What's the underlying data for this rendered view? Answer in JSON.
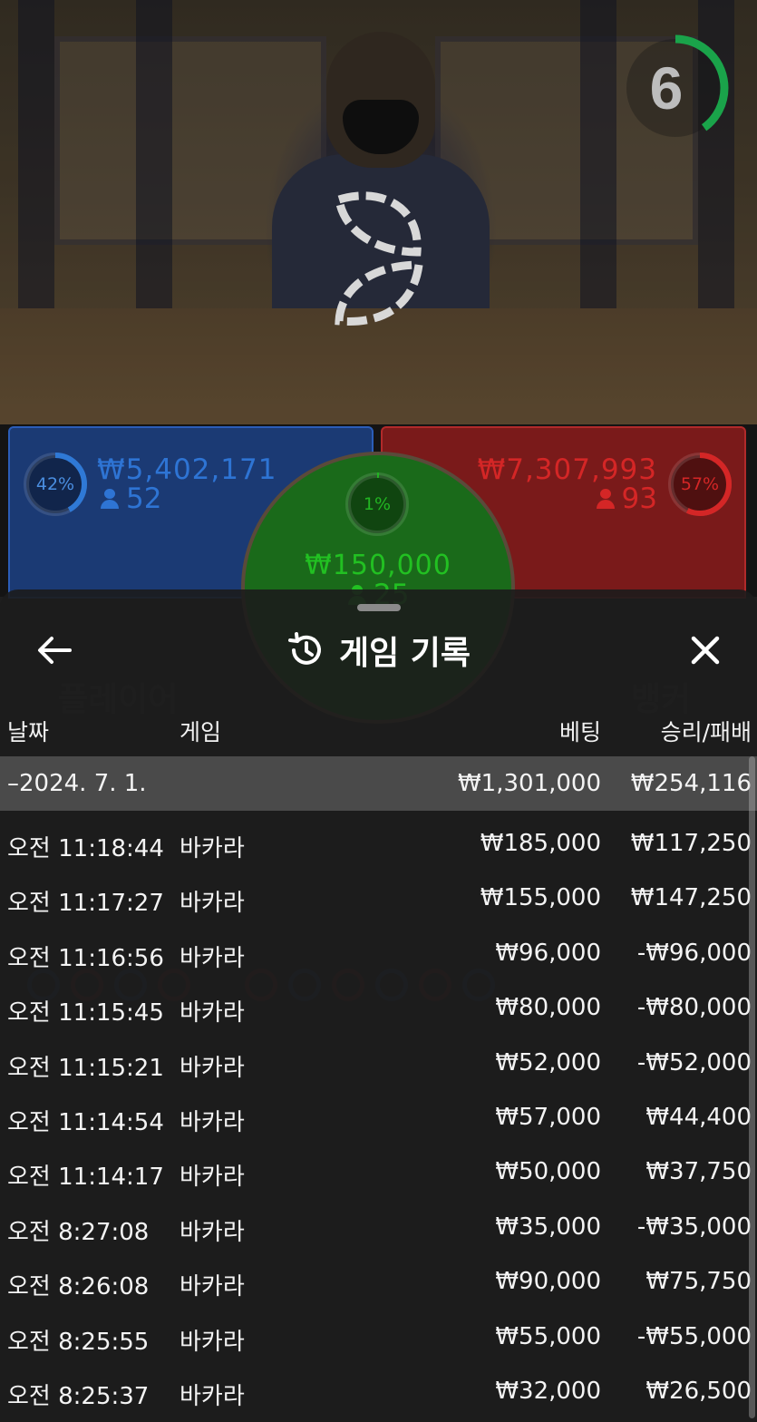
{
  "video": {
    "countdown": "6",
    "countdown_fraction": 0.4
  },
  "board": {
    "player": {
      "percent": "42%",
      "amount": "₩5,402,171",
      "count": "52",
      "percent_value": 0.42,
      "color": "#2f79d6"
    },
    "banker": {
      "percent": "57%",
      "amount": "₩7,307,993",
      "count": "93",
      "percent_value": 0.57,
      "color": "#d42626"
    },
    "tie": {
      "percent": "1%",
      "amount": "₩150,000",
      "count": "25",
      "color": "#22b522"
    }
  },
  "sheet": {
    "title": "게임 기록",
    "back_icon": "arrow-left-icon",
    "history_icon": "history-clock-icon",
    "close_icon": "close-icon",
    "columns": {
      "date": "날짜",
      "game": "게임",
      "bet": "베팅",
      "win_loss": "승리/패배"
    },
    "group": {
      "date": "–2024. 7. 1.",
      "bet": "₩1,301,000",
      "win_loss": "₩254,116"
    },
    "rows": [
      {
        "time": "오전 11:18:44",
        "game": "바카라",
        "bet": "₩185,000",
        "win_loss": "₩117,250"
      },
      {
        "time": "오전 11:17:27",
        "game": "바카라",
        "bet": "₩155,000",
        "win_loss": "₩147,250"
      },
      {
        "time": "오전 11:16:56",
        "game": "바카라",
        "bet": "₩96,000",
        "win_loss": "-₩96,000"
      },
      {
        "time": "오전 11:15:45",
        "game": "바카라",
        "bet": "₩80,000",
        "win_loss": "-₩80,000"
      },
      {
        "time": "오전 11:15:21",
        "game": "바카라",
        "bet": "₩52,000",
        "win_loss": "-₩52,000"
      },
      {
        "time": "오전 11:14:54",
        "game": "바카라",
        "bet": "₩57,000",
        "win_loss": "₩44,400"
      },
      {
        "time": "오전 11:14:17",
        "game": "바카라",
        "bet": "₩50,000",
        "win_loss": "₩37,750"
      },
      {
        "time": "오전 8:27:08",
        "game": "바카라",
        "bet": "₩35,000",
        "win_loss": "-₩35,000"
      },
      {
        "time": "오전 8:26:08",
        "game": "바카라",
        "bet": "₩90,000",
        "win_loss": "₩75,750"
      },
      {
        "time": "오전 8:25:55",
        "game": "바카라",
        "bet": "₩55,000",
        "win_loss": "-₩55,000"
      },
      {
        "time": "오전 8:25:37",
        "game": "바카라",
        "bet": "₩32,000",
        "win_loss": "₩26,500"
      }
    ]
  }
}
